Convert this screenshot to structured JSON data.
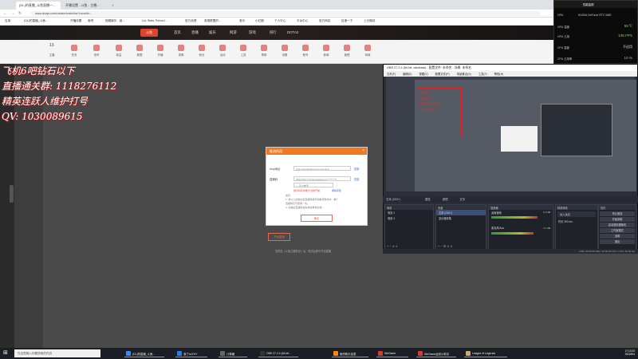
{
  "browser": {
    "tabs": [
      {
        "label": "(DL)的直播_斗鱼直播一..."
      },
      {
        "label": "开播设置 - 斗鱼 - 主播..."
      }
    ],
    "new_tab": "+",
    "url": "www.douyu.com/creator/main/live?roomId=...",
    "bookmarks": [
      "应用",
      "(DL)的直播_斗鱼...",
      "开播设置",
      "鱼吧",
      "抳箱娱乐 - 锁...",
      "LoL Stats, Record...",
      "官方战绩",
      "英雄联盟的...",
      "音乐",
      "小红圈",
      "个人中心",
      "平台中心",
      "官方网站",
      "百度一下",
      "上分路线"
    ]
  },
  "site": {
    "logo": "斗鱼",
    "nav": [
      "首页",
      "直播",
      "娱乐",
      "网游",
      "游戏",
      "排行",
      "DOTA2"
    ],
    "tools": [
      "主播",
      "任务",
      "信号",
      "收益",
      "数据",
      "开播",
      "录像",
      "粉丝",
      "活动",
      "工具",
      "帮助",
      "设置",
      "账号",
      "新闻",
      "管理",
      "商城"
    ],
    "counter": "13"
  },
  "overlay": {
    "lines": [
      "飞机6吧钻石以下",
      "直播通关群: 1118276112",
      "精英连跃人维护打号",
      "QV: 1030089615"
    ]
  },
  "dialog": {
    "title": "推流所用",
    "close": "×",
    "rtmp_label": "rtmp地址",
    "rtmp_value": "rtmp://sendtc3a.douyu.com/live",
    "rtmp_copy": "复制",
    "code_label": "直播码",
    "code_value": "2653796n7y3Ti3s?wsSecret=**********",
    "code_copy": "复制",
    "select_value": "— 平台推流",
    "warning": "推流码有效期为当前开播",
    "warning_link": "重新获取",
    "notes": [
      "提示：",
      "1. 将以上的地址和直播码填写到推流软件中，每个",
      "直播码仅可使用一次。",
      "2. 关播后直播码会失效并重新生成。"
    ],
    "button": "确定"
  },
  "page": {
    "start_button": "开始直播",
    "footnote": "请同意《斗鱼主播协议》后，推流后即可开启直播"
  },
  "obs": {
    "title": "OBS 27.2.4 (64-bit, windows) - 配置文件: 未命名 - 场景: 未命名",
    "menu": [
      "文件(F)",
      "编辑(E)",
      "视图(V)",
      "配置文件(P)",
      "场景集合(S)",
      "工具(T)",
      "帮助(H)"
    ],
    "redbox_lines": [
      "飞机6吧",
      "直播通关群",
      "精英连跃人维护打号",
      "QV:1030089615"
    ],
    "source_bar": "文本 (GDI+)",
    "source_bar_tabs": [
      "属性",
      "滤镜",
      "文字"
    ],
    "docks": {
      "scenes": {
        "title": "场景",
        "items": [
          "场景 2",
          "场景 3"
        ]
      },
      "sources": {
        "title": "来源",
        "items": [
          "文本 (GDI+)",
          "显示器采集"
        ]
      },
      "mixer": {
        "title": "混音器",
        "channels": [
          {
            "name": "桌面音频",
            "db": "0.0 dB",
            "level": 0.78
          },
          {
            "name": "麦克风/Aux",
            "db": "-1.7 dB",
            "level": 0.72
          }
        ]
      },
      "transitions": {
        "title": "转场特效",
        "type": "淡入淡出",
        "duration_label": "时长",
        "duration": "300 ms"
      },
      "controls": {
        "title": "控件",
        "buttons": [
          "停止推流",
          "开始录制",
          "启动虚拟摄像机",
          "工作室模式",
          "设置",
          "退出"
        ]
      }
    },
    "status": "LIVE: 00:00:05  REC: 00:00:00  CPU: 2.4%, 60.00 fps"
  },
  "perf": {
    "title": "性能监视",
    "gpu_label": "GPU",
    "gpu_name": "NVIDIA GeForce RTX 3080",
    "rows": [
      {
        "label": "GPU 温度",
        "value": "55℃"
      },
      {
        "label": "GPU 占用",
        "value": "135 FPS"
      },
      {
        "label": "CPU 温度",
        "value": "不适用"
      },
      {
        "label": "CPU 占用率",
        "value": "10 %"
      }
    ]
  },
  "taskbar": {
    "search": "在这里输入你要搜索的内容",
    "items": [
      {
        "label": "(DL)的直播_斗鱼...",
        "color": "#4285f4"
      },
      {
        "label": "诶了hoTHY",
        "color": "#2b7de9"
      },
      {
        "label": "计算器",
        "color": "#666666"
      },
      {
        "label": "OBS 27.2.4 (64-bit...",
        "color": "#333333"
      },
      {
        "label": "鱼吧助手连麦",
        "color": "#ff8a00"
      },
      {
        "label": "WeGame",
        "color": "#d43a3a"
      },
      {
        "label": "WeGame运动小助手",
        "color": "#d43a3a"
      },
      {
        "label": "League of Legends",
        "color": "#c8aa6e"
      }
    ],
    "time": "17:13:03",
    "date": "2022/8/4"
  }
}
